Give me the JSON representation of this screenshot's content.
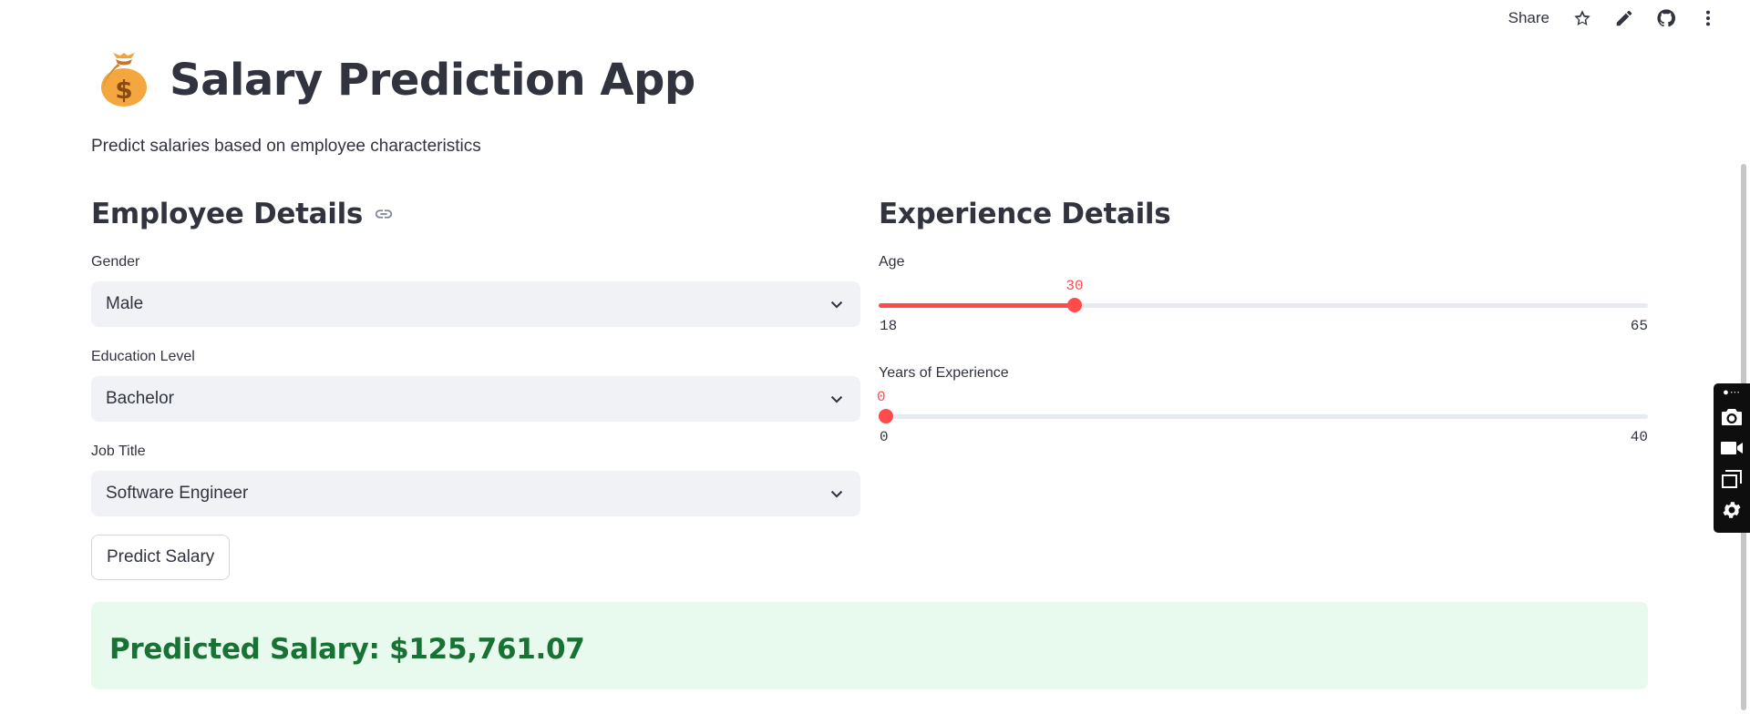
{
  "toolbar": {
    "share_label": "Share",
    "icons": [
      "star-icon",
      "edit-pencil-icon",
      "github-icon",
      "more-vertical-icon"
    ]
  },
  "header": {
    "emoji": "money-bag-icon",
    "title": "Salary Prediction App",
    "subtitle": "Predict salaries based on employee characteristics"
  },
  "employee": {
    "heading": "Employee Details",
    "gender": {
      "label": "Gender",
      "value": "Male"
    },
    "education": {
      "label": "Education Level",
      "value": "Bachelor"
    },
    "job": {
      "label": "Job Title",
      "value": "Software Engineer"
    },
    "predict_label": "Predict Salary"
  },
  "experience": {
    "heading": "Experience Details",
    "age": {
      "label": "Age",
      "value": 30,
      "min": 18,
      "max": 65
    },
    "years": {
      "label": "Years of Experience",
      "value": 0,
      "min": 0,
      "max": 40
    }
  },
  "result": {
    "text": "Predicted Salary: $125,761.07"
  },
  "colors": {
    "accent": "#ff4b4b",
    "success_bg": "#e8f9ee",
    "success_text": "#177233",
    "input_bg": "#f0f2f6"
  }
}
